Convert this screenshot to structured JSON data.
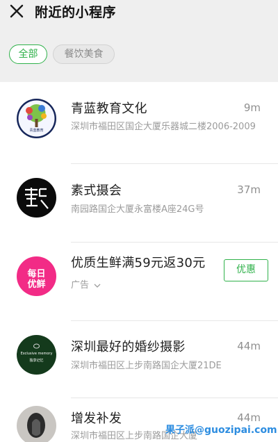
{
  "header": {
    "close_icon": "close-icon",
    "title": "附近的小程序"
  },
  "filters": {
    "all_label": "全部",
    "food_label": "餐饮美食",
    "accent_color": "#2fb14a"
  },
  "items": [
    {
      "name": "青蓝教育文化",
      "address": "深圳市福田区国企大厦乐器城二楼2006-2009",
      "distance": "9m",
      "avatar_text": "青蓝教育"
    },
    {
      "name": "素式摄会",
      "address": "南园路国企大厦永富楼A座24G号",
      "distance": "37m"
    },
    {
      "name": "优质生鲜满59元返30元",
      "ad_label": "广告",
      "button_label": "优惠",
      "avatar_line1": "每日",
      "avatar_line2": "优鲜"
    },
    {
      "name": "深圳最好的婚纱摄影",
      "address": "深圳市福田区上步南路国企大厦21DE",
      "distance": "44m",
      "avatar_line1": "Exclusive memory",
      "avatar_line2": "独享记忆"
    },
    {
      "name": "增发补发",
      "address": "深圳市福田区上步南路国企大厦",
      "distance": "44m"
    }
  ],
  "watermark": "果子派@guozipai.com"
}
